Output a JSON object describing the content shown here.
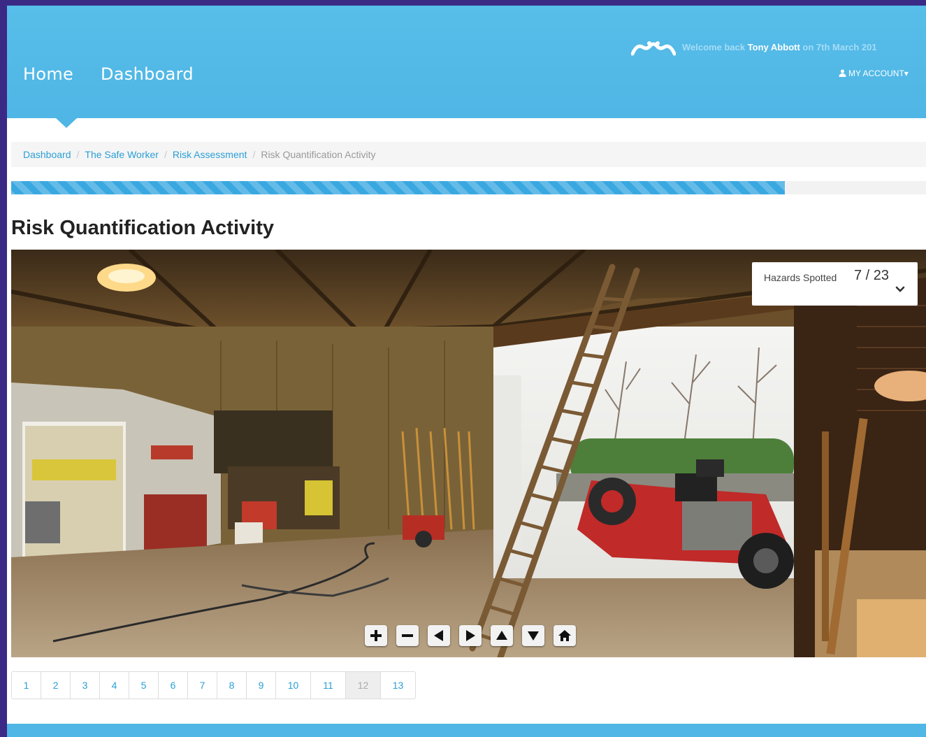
{
  "header": {
    "nav": [
      {
        "label": "Home"
      },
      {
        "label": "Dashboard"
      }
    ],
    "welcome_prefix": "Welcome back ",
    "user_name": "Tony Abbott",
    "welcome_suffix": " on 7th March 201",
    "account_label": "MY ACCOUNT",
    "account_caret": "▾",
    "accent": "#4fb6e5"
  },
  "breadcrumb": {
    "items": [
      {
        "label": "Dashboard",
        "link": true
      },
      {
        "label": "The Safe Worker",
        "link": true
      },
      {
        "label": "Risk Assessment",
        "link": true
      },
      {
        "label": "Risk Quantification Activity",
        "link": false
      }
    ],
    "separator": "/"
  },
  "progress": {
    "fraction": 0.846,
    "color": "#3aa8e0"
  },
  "page_title": "Risk Quantification Activity",
  "panorama": {
    "hazards_label": "Hazards Spotted",
    "hazards_count": "7 / 23",
    "controls": [
      {
        "icon": "zoom-in-icon"
      },
      {
        "icon": "zoom-out-icon"
      },
      {
        "icon": "pan-left-icon"
      },
      {
        "icon": "pan-right-icon"
      },
      {
        "icon": "pan-up-icon"
      },
      {
        "icon": "pan-down-icon"
      },
      {
        "icon": "home-icon"
      }
    ]
  },
  "pagination": {
    "pages": [
      "1",
      "2",
      "3",
      "4",
      "5",
      "6",
      "7",
      "8",
      "9",
      "10",
      "11",
      "12",
      "13"
    ],
    "active": "12"
  }
}
